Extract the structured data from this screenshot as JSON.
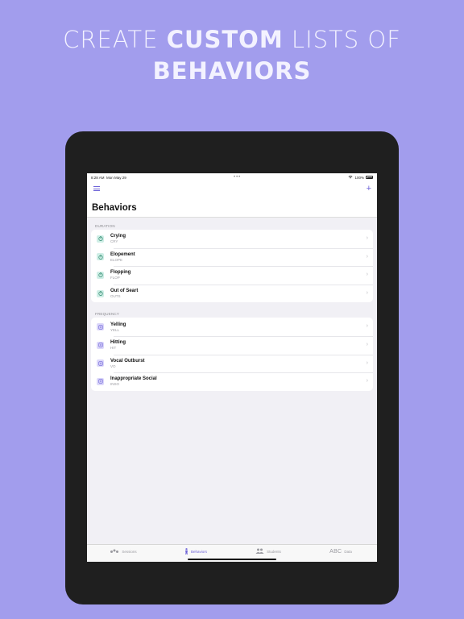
{
  "headline": {
    "line1_regular_a": "CREATE ",
    "line1_bold": "CUSTOM",
    "line1_regular_b": " LISTS OF",
    "line2_bold": "BEHAVIORS"
  },
  "statusbar": {
    "time": "8:28 AM",
    "date": "Mon May 29",
    "dots": "•••",
    "battery": "100%"
  },
  "navbar": {
    "title": "Behaviors",
    "plus": "+"
  },
  "sections": [
    {
      "header": "DURATION",
      "items": [
        {
          "name": "Crying",
          "code": "CRY"
        },
        {
          "name": "Elopement",
          "code": "ELOPE"
        },
        {
          "name": "Flopping",
          "code": "FLOP"
        },
        {
          "name": "Out of Seart",
          "code": "OUTS"
        }
      ]
    },
    {
      "header": "FREQUENCY",
      "items": [
        {
          "name": "Yelling",
          "code": "YELL"
        },
        {
          "name": "Hitting",
          "code": "HIT"
        },
        {
          "name": "Vocal Outburst",
          "code": "VO"
        },
        {
          "name": "Inappropriate Social",
          "code": "INSO"
        }
      ]
    }
  ],
  "tabbar": {
    "tabs": [
      {
        "label": "Sessions",
        "icon": "sessions-icon"
      },
      {
        "label": "Behaviors",
        "icon": "behaviors-icon"
      },
      {
        "label": "Students",
        "icon": "students-icon"
      },
      {
        "label": "Data",
        "icon": "abc-icon",
        "icon_text": "ABC"
      }
    ],
    "active": "Behaviors"
  },
  "colors": {
    "background": "#a29ded",
    "accent": "#6d62d8",
    "duration_icon_bg": "#cfeee6",
    "frequency_icon_bg": "#dcd8fa"
  }
}
